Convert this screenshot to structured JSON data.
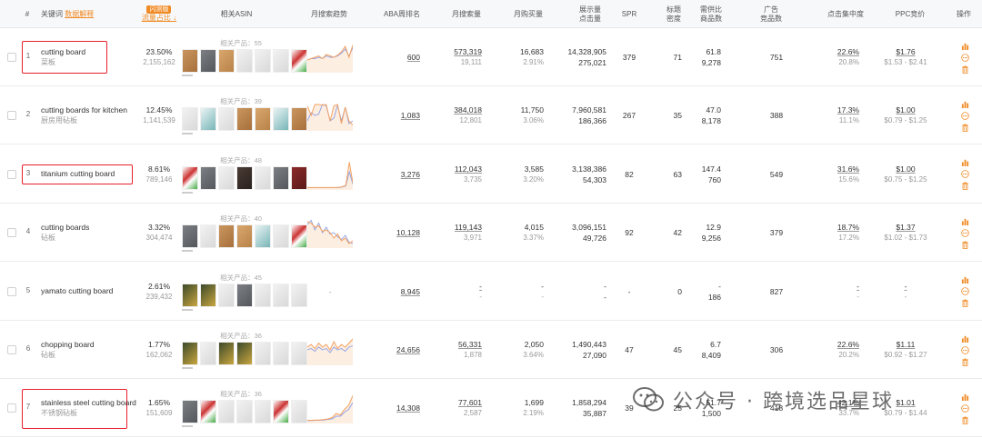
{
  "header": {
    "index": "#",
    "keyword": "关键词",
    "data_explain": "数据解释",
    "flow_badge": "闪测版",
    "flow_share": "流量占比",
    "related_asin": "相关ASIN",
    "monthly_trend": "月搜索趋势",
    "aba_rank": "ABA周排名",
    "monthly_search": "月搜索量",
    "monthly_purchase": "月购买量",
    "impressions": "展示量",
    "clicks": "点击量",
    "spr": "SPR",
    "title_density_1": "标题",
    "title_density_2": "密度",
    "supply_ratio_1": "需供比",
    "supply_ratio_2": "商品数",
    "ad_products_1": "广告",
    "ad_products_2": "竞品数",
    "click_concentration": "点击集中度",
    "ppc_bid": "PPC竞价",
    "actions": "操作"
  },
  "colors": {
    "accent": "#f08a24",
    "highlight_box": "#e8202a",
    "spark_search": "#f4a261",
    "spark_purchase": "#8c9ee6"
  },
  "rows": [
    {
      "index": "1",
      "keyword": "cutting board",
      "keyword_cn": "菜板",
      "share": "23.50%",
      "share_sub": "2,155,162",
      "related_label": "相关产品：55",
      "aba_rank": "600",
      "search": "573,319",
      "search_sub": "19,111",
      "purchase": "16,683",
      "purchase_sub": "2.91%",
      "impressions": "14,328,905",
      "clicks": "275,021",
      "spr": "379",
      "title_density": "71",
      "supply_ratio": "61.8",
      "products": "9,278",
      "ad_products": "751",
      "conc_top": "22.6%",
      "conc_sub": "20.8%",
      "ppc": "$1.76",
      "ppc_range": "$1.53 - $2.41",
      "thumbs": [
        "wood",
        "grey",
        "wood2",
        "light",
        "light",
        "light",
        "mix"
      ],
      "spark": [
        0.4,
        0.45,
        0.5,
        0.55,
        0.45,
        0.6,
        0.55,
        0.5,
        0.58,
        0.7,
        0.9,
        0.5,
        0.95
      ],
      "spark2": [
        0.4,
        0.45,
        0.45,
        0.5,
        0.45,
        0.55,
        0.5,
        0.5,
        0.55,
        0.65,
        0.8,
        0.55,
        0.85
      ],
      "highlight": true
    },
    {
      "index": "2",
      "keyword": "cutting boards for kitchen",
      "keyword_cn": "厨房用砧板",
      "share": "12.45%",
      "share_sub": "1,141,539",
      "related_label": "相关产品：39",
      "aba_rank": "1,083",
      "search": "384,018",
      "search_sub": "12,801",
      "purchase": "11,750",
      "purchase_sub": "3.06%",
      "impressions": "7,960,581",
      "clicks": "186,366",
      "spr": "267",
      "title_density": "35",
      "supply_ratio": "47.0",
      "products": "8,178",
      "ad_products": "388",
      "conc_top": "17.3%",
      "conc_sub": "11.1%",
      "ppc": "$1.00",
      "ppc_range": "$0.79 - $1.25",
      "thumbs": [
        "light",
        "teal",
        "light",
        "wood",
        "wood2",
        "teal",
        "wood"
      ],
      "spark": [
        0.85,
        0.5,
        0.9,
        0.9,
        0.88,
        0.9,
        0.3,
        0.85,
        0.9,
        0.2,
        0.8,
        0.3,
        0.15
      ],
      "spark2": [
        0.3,
        0.6,
        0.5,
        0.55,
        0.9,
        0.85,
        0.3,
        0.4,
        0.88,
        0.3,
        0.8,
        0.2,
        0.3
      ],
      "highlight": false
    },
    {
      "index": "3",
      "keyword": "titanium cutting board",
      "keyword_cn": "",
      "share": "8.61%",
      "share_sub": "789,146",
      "related_label": "相关产品：48",
      "aba_rank": "3,276",
      "search": "112,043",
      "search_sub": "3,735",
      "purchase": "3,585",
      "purchase_sub": "3.20%",
      "impressions": "3,138,386",
      "clicks": "54,303",
      "spr": "82",
      "title_density": "63",
      "supply_ratio": "147.4",
      "products": "760",
      "ad_products": "549",
      "conc_top": "31.6%",
      "conc_sub": "15.6%",
      "ppc": "$1.00",
      "ppc_range": "$0.75 - $1.25",
      "thumbs": [
        "mix",
        "grey",
        "light",
        "dark",
        "light",
        "grey",
        "red"
      ],
      "spark": [
        0.02,
        0.02,
        0.02,
        0.02,
        0.02,
        0.02,
        0.02,
        0.02,
        0.02,
        0.03,
        0.05,
        0.1,
        0.95,
        0.2
      ],
      "spark2": [
        0.02,
        0.02,
        0.02,
        0.02,
        0.02,
        0.02,
        0.02,
        0.02,
        0.02,
        0.02,
        0.04,
        0.08,
        0.6,
        0.15
      ],
      "highlight": true
    },
    {
      "index": "4",
      "keyword": "cutting boards",
      "keyword_cn": "砧板",
      "share": "3.32%",
      "share_sub": "304,474",
      "related_label": "相关产品：40",
      "aba_rank": "10,128",
      "search": "119,143",
      "search_sub": "3,971",
      "purchase": "4,015",
      "purchase_sub": "3.37%",
      "impressions": "3,096,151",
      "clicks": "49,726",
      "spr": "92",
      "title_density": "42",
      "supply_ratio": "12.9",
      "products": "9,256",
      "ad_products": "379",
      "conc_top": "18.7%",
      "conc_sub": "17.2%",
      "ppc": "$1.37",
      "ppc_range": "$1.02 - $1.73",
      "thumbs": [
        "grey",
        "light",
        "wood",
        "wood2",
        "teal",
        "light",
        "mix"
      ],
      "spark": [
        0.9,
        0.85,
        0.7,
        0.75,
        0.55,
        0.6,
        0.5,
        0.3,
        0.45,
        0.2,
        0.3,
        0.1,
        0.2
      ],
      "spark2": [
        0.8,
        0.95,
        0.6,
        0.85,
        0.5,
        0.7,
        0.45,
        0.5,
        0.35,
        0.25,
        0.4,
        0.15,
        0.1
      ],
      "highlight": false
    },
    {
      "index": "5",
      "keyword": "yamato cutting board",
      "keyword_cn": "",
      "share": "2.61%",
      "share_sub": "239,432",
      "related_label": "相关产品：45",
      "aba_rank": "8,945",
      "search": "-",
      "search_sub": "-",
      "purchase": "-",
      "purchase_sub": "-",
      "impressions": "-",
      "clicks": "-",
      "spr": "-",
      "title_density": "0",
      "supply_ratio": "-",
      "products": "186",
      "ad_products": "827",
      "conc_top": "-",
      "conc_sub": "-",
      "ppc": "-",
      "ppc_range": "-",
      "thumbs": [
        "green",
        "green",
        "light",
        "grey",
        "light",
        "light",
        "light"
      ],
      "spark": [],
      "spark2": [],
      "spark_empty": "-",
      "highlight": false
    },
    {
      "index": "6",
      "keyword": "chopping board",
      "keyword_cn": "砧板",
      "share": "1.77%",
      "share_sub": "162,062",
      "related_label": "相关产品：36",
      "aba_rank": "24,656",
      "search": "56,331",
      "search_sub": "1,878",
      "purchase": "2,050",
      "purchase_sub": "3.64%",
      "impressions": "1,490,443",
      "clicks": "27,090",
      "spr": "47",
      "title_density": "45",
      "supply_ratio": "6.7",
      "products": "8,409",
      "ad_products": "306",
      "conc_top": "22.6%",
      "conc_sub": "20.2%",
      "ppc": "$1.11",
      "ppc_range": "$0.92 - $1.27",
      "thumbs": [
        "green",
        "light",
        "green",
        "green",
        "light",
        "light",
        "light"
      ],
      "spark": [
        0.6,
        0.7,
        0.55,
        0.75,
        0.6,
        0.7,
        0.5,
        0.8,
        0.55,
        0.7,
        0.6,
        0.75,
        0.9
      ],
      "spark2": [
        0.5,
        0.55,
        0.45,
        0.6,
        0.5,
        0.55,
        0.4,
        0.6,
        0.5,
        0.55,
        0.45,
        0.6,
        0.65
      ],
      "highlight": false
    },
    {
      "index": "7",
      "keyword": "stainless steel cutting board",
      "keyword_cn": "不锈钢砧板",
      "share": "1.65%",
      "share_sub": "151,609",
      "related_label": "相关产品：36",
      "aba_rank": "14,308",
      "search": "77,601",
      "search_sub": "2,587",
      "purchase": "1,699",
      "purchase_sub": "2.19%",
      "impressions": "1,858,294",
      "clicks": "35,887",
      "spr": "39",
      "title_density": "25",
      "supply_ratio": "51.7",
      "products": "1,500",
      "ad_products": "418",
      "conc_top": "42.1%",
      "conc_sub": "33.7%",
      "ppc": "$1.01",
      "ppc_range": "$0.79 - $1.44",
      "thumbs": [
        "grey",
        "mix",
        "light",
        "light",
        "light",
        "mix",
        "light"
      ],
      "spark": [
        0.05,
        0.05,
        0.06,
        0.06,
        0.08,
        0.1,
        0.15,
        0.3,
        0.25,
        0.45,
        0.6,
        0.95
      ],
      "spark2": [
        0.04,
        0.04,
        0.05,
        0.05,
        0.06,
        0.08,
        0.1,
        0.2,
        0.2,
        0.35,
        0.45,
        0.7
      ],
      "highlight": true
    }
  ],
  "watermark": {
    "text": "公众号 · 跨境选品星球",
    "icon": "wechat-icon"
  }
}
